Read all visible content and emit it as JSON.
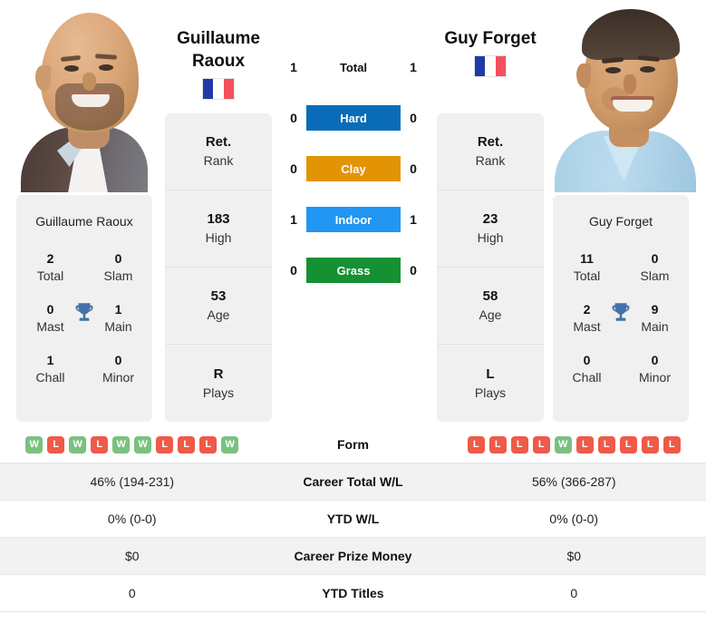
{
  "players": {
    "left": {
      "name": "Guillaume Raoux",
      "name_line1": "Guillaume",
      "name_line2": "Raoux",
      "country_flag": "france-flag",
      "photo": "player-photo-guillaume-raoux",
      "stats": [
        {
          "value": "Ret.",
          "label": "Rank"
        },
        {
          "value": "183",
          "label": "High"
        },
        {
          "value": "53",
          "label": "Age"
        },
        {
          "value": "R",
          "label": "Plays"
        }
      ],
      "titles": [
        {
          "value": "2",
          "label": "Total"
        },
        {
          "value": "0",
          "label": "Slam"
        },
        {
          "value": "0",
          "label": "Mast"
        },
        {
          "value": "1",
          "label": "Main"
        },
        {
          "value": "1",
          "label": "Chall"
        },
        {
          "value": "0",
          "label": "Minor"
        }
      ],
      "form": [
        "W",
        "L",
        "W",
        "L",
        "W",
        "W",
        "L",
        "L",
        "L",
        "W"
      ],
      "career_total_wl": "46% (194-231)",
      "ytd_wl": "0% (0-0)",
      "career_prize_money": "$0",
      "ytd_titles": "0"
    },
    "right": {
      "name": "Guy Forget",
      "name_line1": "Guy Forget",
      "name_line2": "",
      "country_flag": "france-flag",
      "photo": "player-photo-guy-forget",
      "stats": [
        {
          "value": "Ret.",
          "label": "Rank"
        },
        {
          "value": "23",
          "label": "High"
        },
        {
          "value": "58",
          "label": "Age"
        },
        {
          "value": "L",
          "label": "Plays"
        }
      ],
      "titles": [
        {
          "value": "11",
          "label": "Total"
        },
        {
          "value": "0",
          "label": "Slam"
        },
        {
          "value": "2",
          "label": "Mast"
        },
        {
          "value": "9",
          "label": "Main"
        },
        {
          "value": "0",
          "label": "Chall"
        },
        {
          "value": "0",
          "label": "Minor"
        }
      ],
      "form": [
        "L",
        "L",
        "L",
        "L",
        "W",
        "L",
        "L",
        "L",
        "L",
        "L"
      ],
      "career_total_wl": "56% (366-287)",
      "ytd_wl": "0% (0-0)",
      "career_prize_money": "$0",
      "ytd_titles": "0"
    }
  },
  "head_to_head": [
    {
      "label": "Total",
      "left": "1",
      "right": "1",
      "color": "",
      "text_color": "#111111"
    },
    {
      "label": "Hard",
      "left": "0",
      "right": "0",
      "color": "#0a6cb8",
      "text_color": "#ffffff"
    },
    {
      "label": "Clay",
      "left": "0",
      "right": "0",
      "color": "#e39405",
      "text_color": "#ffffff"
    },
    {
      "label": "Indoor",
      "left": "1",
      "right": "1",
      "color": "#2196f3",
      "text_color": "#ffffff"
    },
    {
      "label": "Grass",
      "left": "0",
      "right": "0",
      "color": "#159033",
      "text_color": "#ffffff"
    }
  ],
  "comparison_rows": [
    {
      "label": "Form",
      "type": "form",
      "shaded": false
    },
    {
      "label": "Career Total W/L",
      "type": "text",
      "shaded": true,
      "left": "46% (194-231)",
      "right": "56% (366-287)"
    },
    {
      "label": "YTD W/L",
      "type": "text",
      "shaded": false,
      "left": "0% (0-0)",
      "right": "0% (0-0)"
    },
    {
      "label": "Career Prize Money",
      "type": "text",
      "shaded": true,
      "left": "$0",
      "right": "$0"
    },
    {
      "label": "YTD Titles",
      "type": "text",
      "shaded": false,
      "left": "0",
      "right": "0"
    }
  ],
  "colors": {
    "hard": "#0a6cb8",
    "clay": "#e39405",
    "indoor": "#2196f3",
    "grass": "#159033",
    "win_badge": "#7ac17f",
    "loss_badge": "#ef5a49",
    "card_bg": "#f0f0f0",
    "row_shaded": "#f2f2f2",
    "trophy": "#4472a8",
    "flag_blue": "#1f3ba8",
    "flag_red": "#f4505e"
  },
  "icons": {
    "trophy": "trophy-icon",
    "flag": "france-flag-icon"
  }
}
